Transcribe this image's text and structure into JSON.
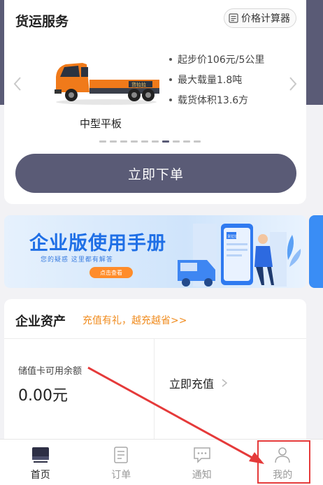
{
  "freight": {
    "title": "货运服务",
    "calculator_label": "价格计算器",
    "vehicle_name": "中型平板",
    "specs": [
      "起步价106元/5公里",
      "最大载量1.8吨",
      "载货体积13.6方"
    ],
    "carousel_total": 10,
    "carousel_active": 6,
    "order_button": "立即下单",
    "truck_logo_text": "货拉拉"
  },
  "banner": {
    "title": "企业版使用手册",
    "subtitle": "您的疑惑  这里都有解答",
    "button": "点击查看",
    "art_text": "货拉拉"
  },
  "assets": {
    "title": "企业资产",
    "promo": "充值有礼，越充越省>>",
    "balance_label": "储值卡可用余额",
    "balance_value": "0.00元",
    "recharge_label": "立即充值"
  },
  "tabbar": {
    "tabs": [
      {
        "label": "首页",
        "icon": "home-icon",
        "active": true
      },
      {
        "label": "订单",
        "icon": "order-icon",
        "active": false
      },
      {
        "label": "通知",
        "icon": "notification-icon",
        "active": false
      },
      {
        "label": "我的",
        "icon": "profile-icon",
        "active": false
      }
    ]
  },
  "colors": {
    "primary": "#5a5b76",
    "accent_orange": "#f08c1f",
    "annotation_red": "#e53a3a",
    "banner_blue": "#1f6fe6"
  }
}
